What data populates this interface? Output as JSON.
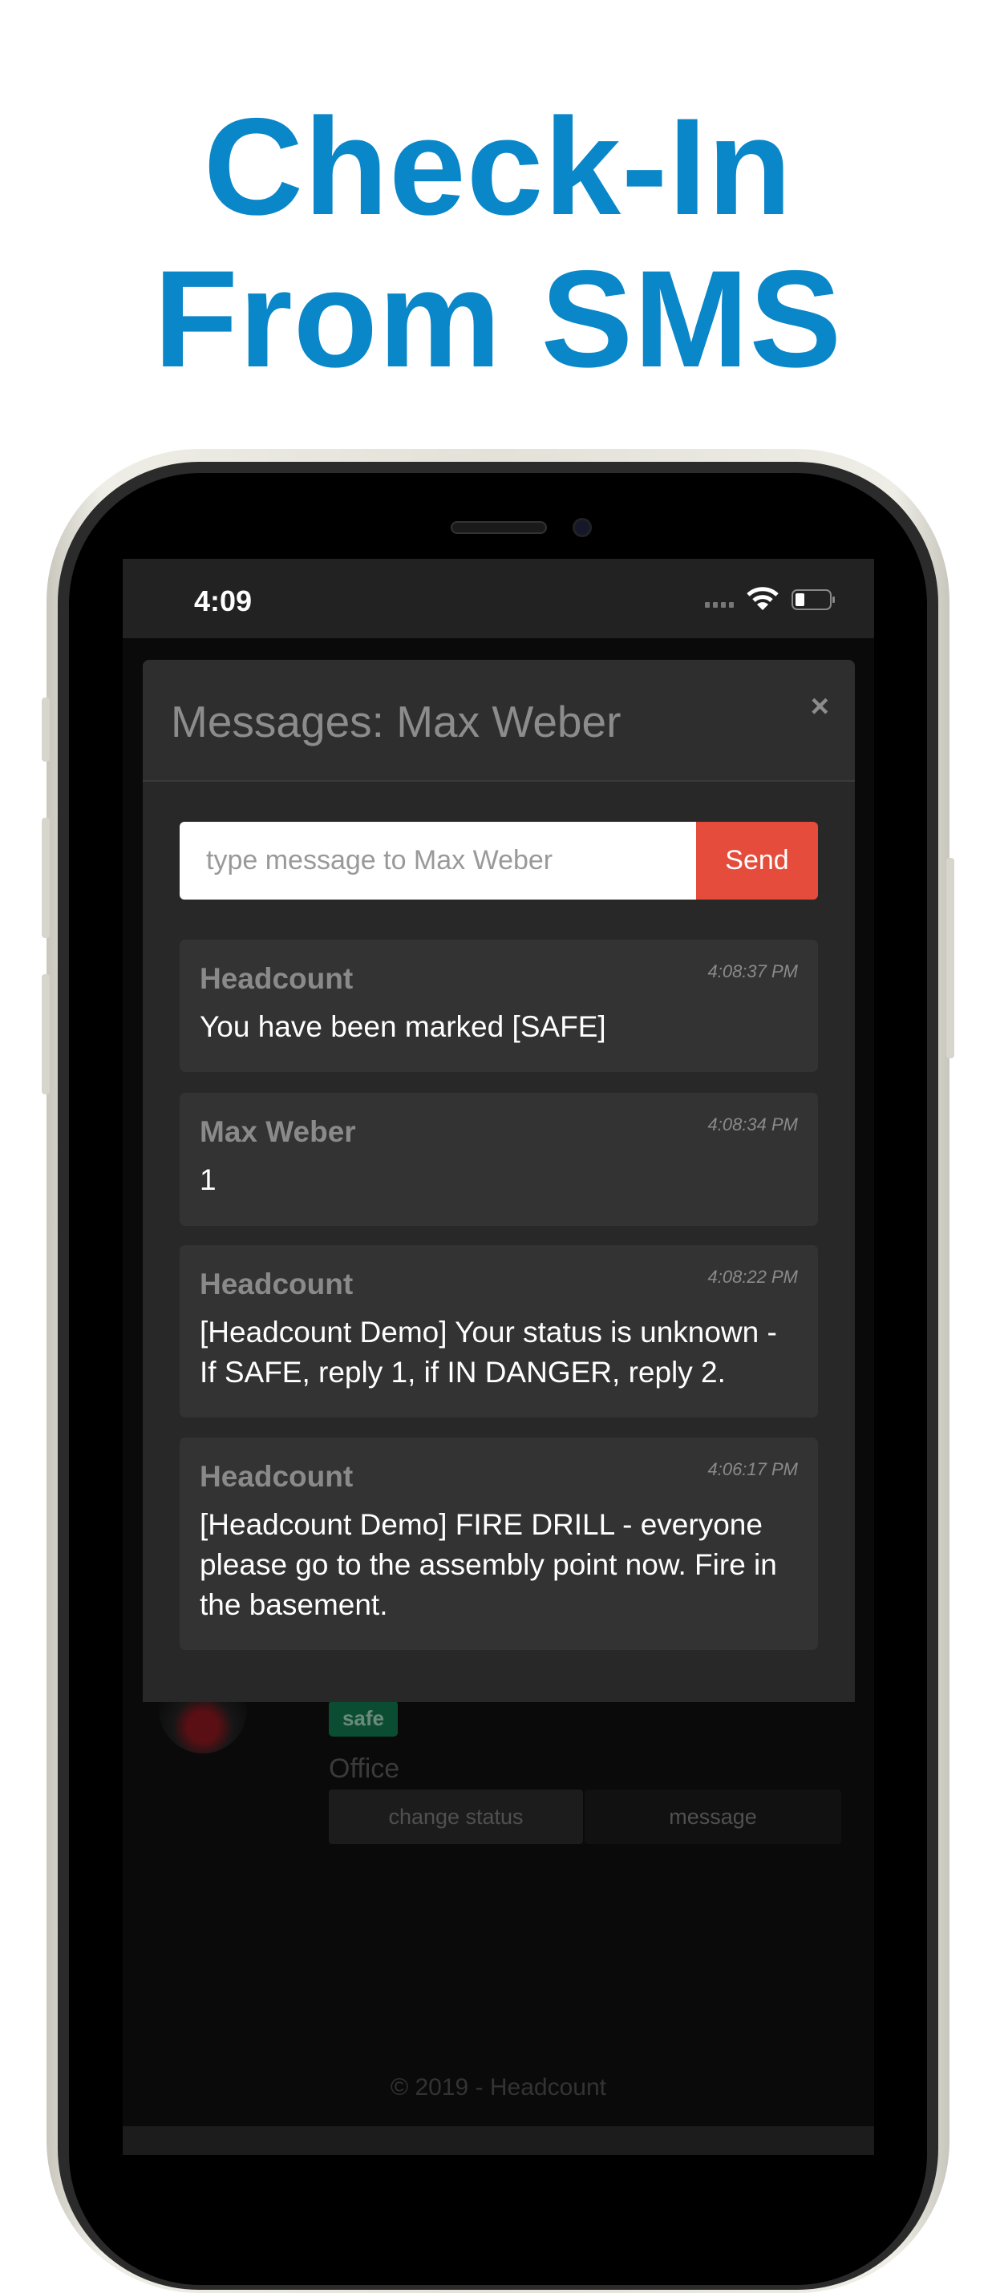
{
  "headline": {
    "line1": "Check-In",
    "line2": "From SMS",
    "color": "#0a87c9"
  },
  "status_bar": {
    "time": "4:09"
  },
  "background_page": {
    "status_badge": "safe",
    "location": "Office",
    "buttons": {
      "change_status": "change status",
      "message": "message"
    },
    "footer": "© 2019 - Headcount"
  },
  "modal": {
    "title": "Messages: Max Weber",
    "close_label": "×",
    "compose": {
      "placeholder": "type message to Max Weber",
      "value": "",
      "send_label": "Send",
      "send_color": "#e54c3c"
    },
    "messages": [
      {
        "sender": "Headcount",
        "time": "4:08:37 PM",
        "text": "You have been marked [SAFE]"
      },
      {
        "sender": "Max Weber",
        "time": "4:08:34 PM",
        "text": "1"
      },
      {
        "sender": "Headcount",
        "time": "4:08:22 PM",
        "text": "[Headcount Demo] Your status is unknown - If SAFE, reply 1, if IN DANGER, reply 2."
      },
      {
        "sender": "Headcount",
        "time": "4:06:17 PM",
        "text": "[Headcount Demo] FIRE DRILL - everyone please go to the assembly point now. Fire in the basement."
      }
    ]
  }
}
